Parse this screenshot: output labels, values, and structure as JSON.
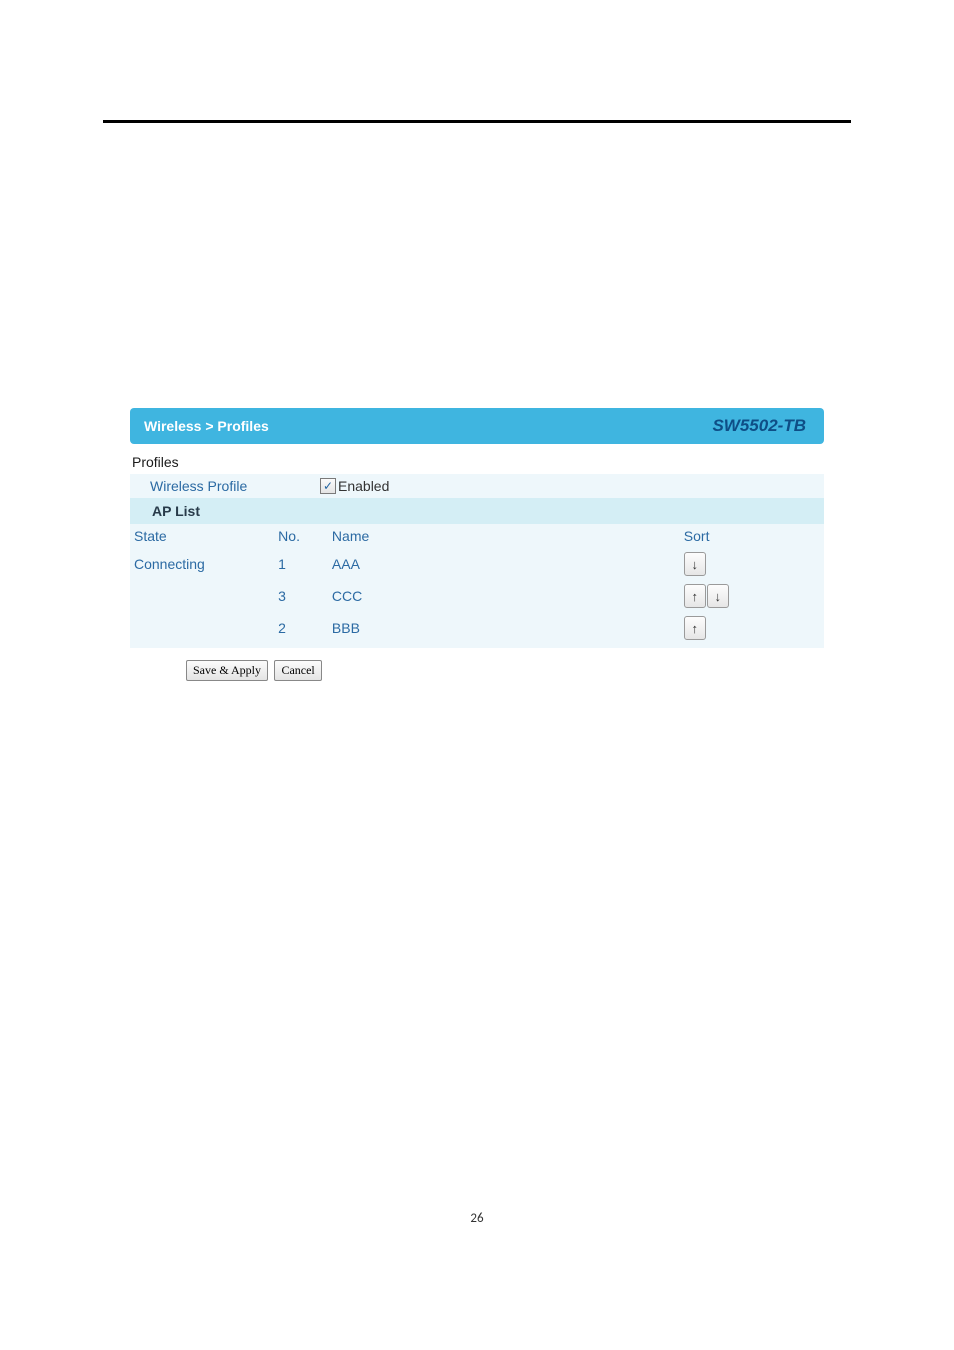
{
  "header": {
    "breadcrumb": "Wireless > Profiles",
    "model": "SW5502-TB"
  },
  "section_title": "Profiles",
  "wireless_profile": {
    "label": "Wireless Profile",
    "enabled_label": "Enabled",
    "enabled_check": "✓"
  },
  "ap_list": {
    "header": "AP List",
    "columns": {
      "state": "State",
      "no": "No.",
      "name": "Name",
      "sort": "Sort"
    },
    "rows": [
      {
        "state": "Connecting",
        "no": "1",
        "name": "AAA",
        "up": false,
        "down": true
      },
      {
        "state": "",
        "no": "3",
        "name": "CCC",
        "up": true,
        "down": true
      },
      {
        "state": "",
        "no": "2",
        "name": "BBB",
        "up": true,
        "down": false
      }
    ]
  },
  "buttons": {
    "save_apply": "Save & Apply",
    "cancel": "Cancel"
  },
  "arrows": {
    "up": "↑",
    "down": "↓"
  },
  "page_number": "26"
}
